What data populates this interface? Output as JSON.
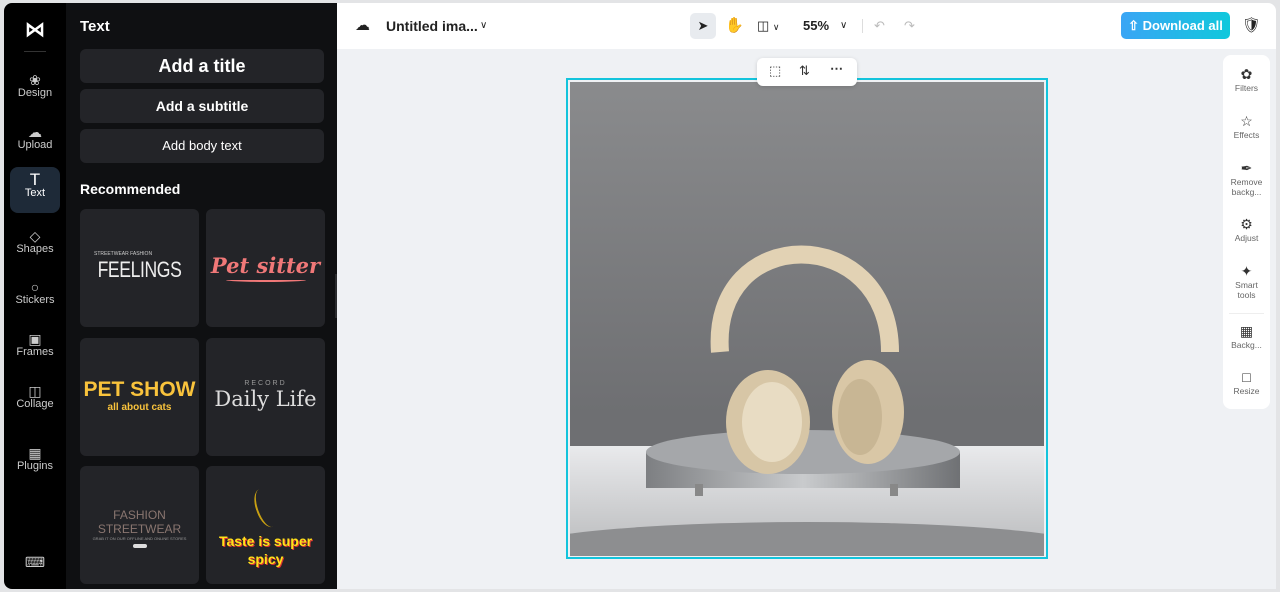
{
  "rail": {
    "items": [
      {
        "label": "Design",
        "icon": "design-icon"
      },
      {
        "label": "Upload",
        "icon": "upload-icon"
      },
      {
        "label": "Text",
        "icon": "text-icon"
      },
      {
        "label": "Shapes",
        "icon": "shapes-icon"
      },
      {
        "label": "Stickers",
        "icon": "stickers-icon"
      },
      {
        "label": "Frames",
        "icon": "frames-icon"
      },
      {
        "label": "Collage",
        "icon": "collage-icon"
      },
      {
        "label": "Plugins",
        "icon": "plugins-icon"
      }
    ],
    "active": "Text"
  },
  "panel": {
    "title": "Text",
    "add_title": "Add a title",
    "add_subtitle": "Add a subtitle",
    "add_body": "Add body text",
    "recommended": "Recommended",
    "templates": [
      {
        "small": "STREETWEAR FASHION",
        "main": "FEELINGS"
      },
      {
        "main": "Pet sitter"
      },
      {
        "main": "PET SHOW",
        "small": "all about cats"
      },
      {
        "small": "RECORD",
        "main": "Daily Life"
      },
      {
        "main": "FASHION STREETWEAR",
        "small": "GRAB IT ON OUR OFFLINE AND ONLINE STORES"
      },
      {
        "main": "Taste is super spicy"
      }
    ]
  },
  "topbar": {
    "file_name": "Untitled ima...",
    "zoom": "55%",
    "download": "Download all"
  },
  "right_tools": [
    {
      "label": "Filters"
    },
    {
      "label": "Effects"
    },
    {
      "label": "Remove backg..."
    },
    {
      "label": "Adjust"
    },
    {
      "label": "Smart tools"
    },
    {
      "label": "Backg..."
    },
    {
      "label": "Resize"
    }
  ],
  "colors": {
    "accent": "#13c4dc",
    "download_start": "#3aa5f5",
    "download_end": "#10c8dc"
  }
}
